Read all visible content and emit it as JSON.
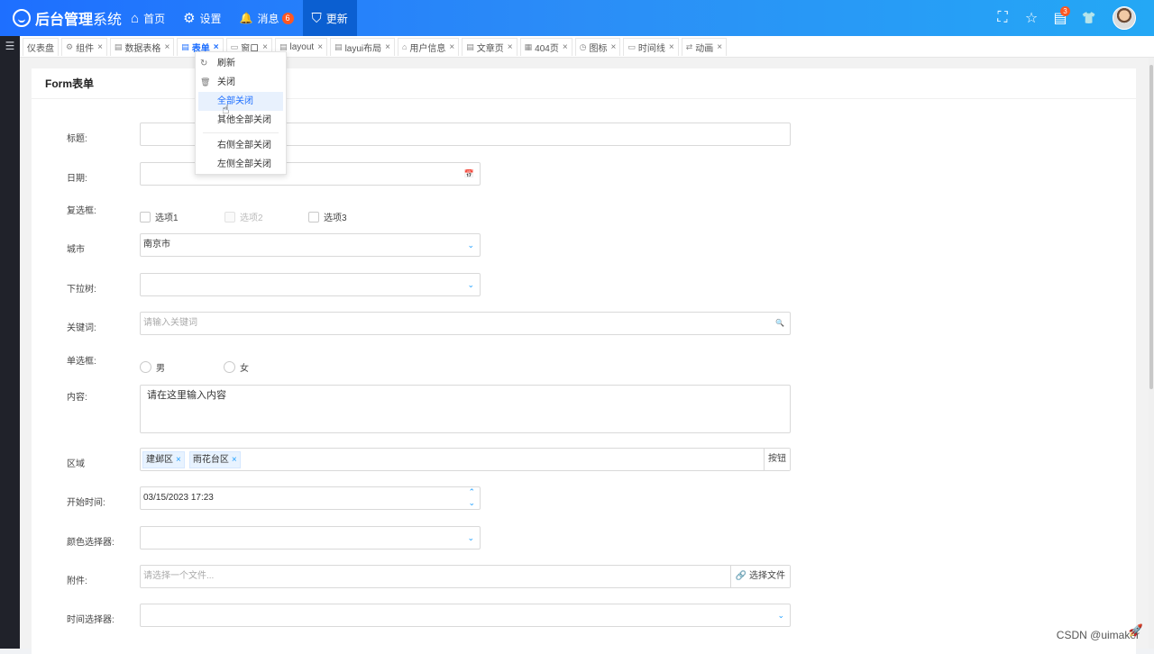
{
  "app": {
    "title": "后台管理",
    "title_suffix": "系统"
  },
  "topnav": [
    {
      "icon": "home-icon",
      "glyph": "⌂",
      "label": "首页",
      "active": false
    },
    {
      "icon": "gear-icon",
      "glyph": "⚙",
      "label": "设置",
      "active": false
    },
    {
      "icon": "bell-icon",
      "glyph": "🔔",
      "label": "消息",
      "badge": "6",
      "active": false
    },
    {
      "icon": "shield-icon",
      "glyph": "⛉",
      "label": "更新",
      "active": true
    }
  ],
  "topright": {
    "fullscreen_glyph": "⛶",
    "star_glyph": "☆",
    "notes_glyph": "▤",
    "notes_badge": "3",
    "shirt_glyph": "👕"
  },
  "sidebar": {
    "menu_glyph": "☰"
  },
  "tabs": [
    {
      "label": "仪表盘",
      "icon": "",
      "closable": false
    },
    {
      "label": "组件",
      "icon": "⚙",
      "closable": true
    },
    {
      "label": "数据表格",
      "icon": "▤",
      "closable": true
    },
    {
      "label": "表单",
      "icon": "▤",
      "closable": true,
      "active": true
    },
    {
      "label": "窗口",
      "icon": "▭",
      "closable": true
    },
    {
      "label": "layout",
      "icon": "▤",
      "closable": true
    },
    {
      "label": "layui布局",
      "icon": "▤",
      "closable": true
    },
    {
      "label": "用户信息",
      "icon": "⌂",
      "closable": true
    },
    {
      "label": "文章页",
      "icon": "▤",
      "closable": true
    },
    {
      "label": "404页",
      "icon": "▦",
      "closable": true
    },
    {
      "label": "图标",
      "icon": "◷",
      "closable": true
    },
    {
      "label": "时间线",
      "icon": "▭",
      "closable": true
    },
    {
      "label": "动画",
      "icon": "⇄",
      "closable": true
    }
  ],
  "tab_close_glyph": "×",
  "context_menu": {
    "refresh": {
      "label": "刷新",
      "glyph": "↻"
    },
    "close": {
      "label": "关闭",
      "glyph": "🗑"
    },
    "close_all": "全部关闭",
    "close_others": "其他全部关闭",
    "close_right": "右侧全部关闭",
    "close_left": "左侧全部关闭"
  },
  "card": {
    "title": "Form表单"
  },
  "form": {
    "title_label": "标题:",
    "date_label": "日期:",
    "date_icon_glyph": "📅",
    "checkbox_label": "复选框:",
    "checkbox_options": [
      "选项1",
      "选项2",
      "选项3"
    ],
    "city_label": "城市",
    "city_value": "南京市",
    "tree_label": "下拉树:",
    "keyword_label": "关键词:",
    "keyword_placeholder": "请输入关键词",
    "search_glyph": "🔍",
    "radio_label": "单选框:",
    "radio_options": [
      "男",
      "女"
    ],
    "content_label": "内容:",
    "content_value": "请在这里输入内容",
    "area_label": "区域",
    "area_tags": [
      "建邺区",
      "雨花台区"
    ],
    "tag_close_glyph": "×",
    "area_button": "按钮",
    "start_time_label": "开始时间:",
    "start_time_value": "03/15/2023 17:23",
    "spinner_up": "⌃",
    "spinner_down": "⌄",
    "color_label": "颜色选择器:",
    "attach_label": "附件:",
    "attach_placeholder": "请选择一个文件...",
    "attach_button": "🔗 选择文件",
    "timepicker_label": "时间选择器:",
    "dropdown_glyph": "⌄"
  },
  "footer": {
    "watermark": "CSDN @uimaker",
    "rocket_glyph": "🚀"
  },
  "cursor_glyph": "☝"
}
